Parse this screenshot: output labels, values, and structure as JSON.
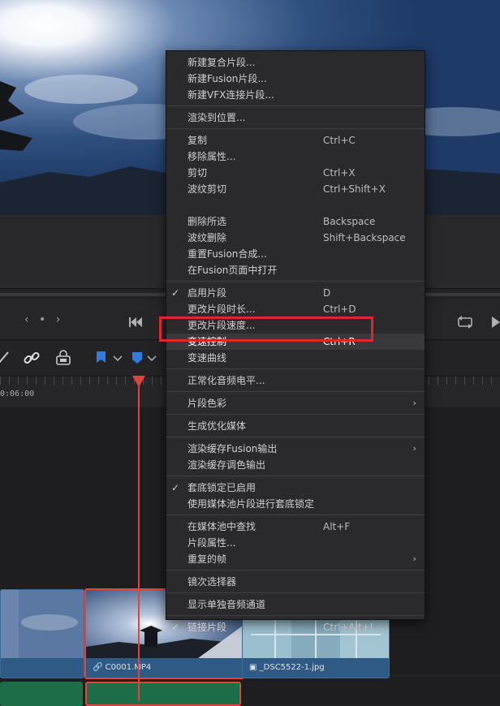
{
  "colors": {
    "menu_bg": "#2a2a2d",
    "menu_text": "#cfcfcf",
    "highlight_box": "#e0252c",
    "playhead": "#e0443a",
    "selected_clip_border": "#e0443a",
    "audio_clip": "#1d6d49",
    "clip_label_bg": "#2f5a86"
  },
  "timeline": {
    "timecode": "0:06:00",
    "clips": [
      {
        "name": "",
        "selected": false
      },
      {
        "name": "C0001.MP4",
        "selected": true,
        "icon": "link-icon"
      },
      {
        "name": "_DSC5522-1.jpg",
        "selected": false,
        "icon": "image-icon"
      }
    ]
  },
  "context_menu": {
    "groups": [
      {
        "items": [
          {
            "label": "新建复合片段..."
          },
          {
            "label": "新建Fusion片段..."
          },
          {
            "label": "新建VFX连接片段..."
          }
        ]
      },
      {
        "items": [
          {
            "label": "渲染到位置..."
          }
        ]
      },
      {
        "items": [
          {
            "label": "复制",
            "shortcut": "Ctrl+C"
          },
          {
            "label": "移除属性..."
          },
          {
            "label": "剪切",
            "shortcut": "Ctrl+X"
          },
          {
            "label": "波纹剪切",
            "shortcut": "Ctrl+Shift+X"
          },
          {
            "label": ""
          },
          {
            "label": "删除所选",
            "shortcut": "Backspace"
          },
          {
            "label": "波纹删除",
            "shortcut": "Shift+Backspace"
          },
          {
            "label": "重置Fusion合成..."
          },
          {
            "label": "在Fusion页面中打开"
          }
        ]
      },
      {
        "items": [
          {
            "label": "启用片段",
            "shortcut": "D",
            "checked": true
          },
          {
            "label": "更改片段时长...",
            "shortcut": "Ctrl+D"
          },
          {
            "label": "更改片段速度..."
          },
          {
            "label": "变速控制",
            "shortcut": "Ctrl+R",
            "highlighted": true
          },
          {
            "label": "变速曲线"
          }
        ]
      },
      {
        "items": [
          {
            "label": "正常化音频电平..."
          }
        ]
      },
      {
        "items": [
          {
            "label": "片段色彩",
            "submenu": true
          }
        ]
      },
      {
        "items": [
          {
            "label": "生成优化媒体"
          }
        ]
      },
      {
        "items": [
          {
            "label": "渲染缓存Fusion输出",
            "submenu": true
          },
          {
            "label": "渲染缓存调色输出"
          }
        ]
      },
      {
        "items": [
          {
            "label": "套底锁定已启用",
            "checked": true
          },
          {
            "label": "使用媒体池片段进行套底锁定"
          }
        ]
      },
      {
        "items": [
          {
            "label": "在媒体池中查找",
            "shortcut": "Alt+F"
          },
          {
            "label": "片段属性..."
          },
          {
            "label": "重复的帧",
            "submenu": true
          }
        ]
      },
      {
        "items": [
          {
            "label": "镜次选择器"
          }
        ]
      },
      {
        "items": [
          {
            "label": "显示单独音频通道"
          }
        ]
      },
      {
        "items": [
          {
            "label": "链接片段",
            "shortcut": "Ctrl+Alt+L",
            "checked": true
          }
        ]
      }
    ]
  }
}
